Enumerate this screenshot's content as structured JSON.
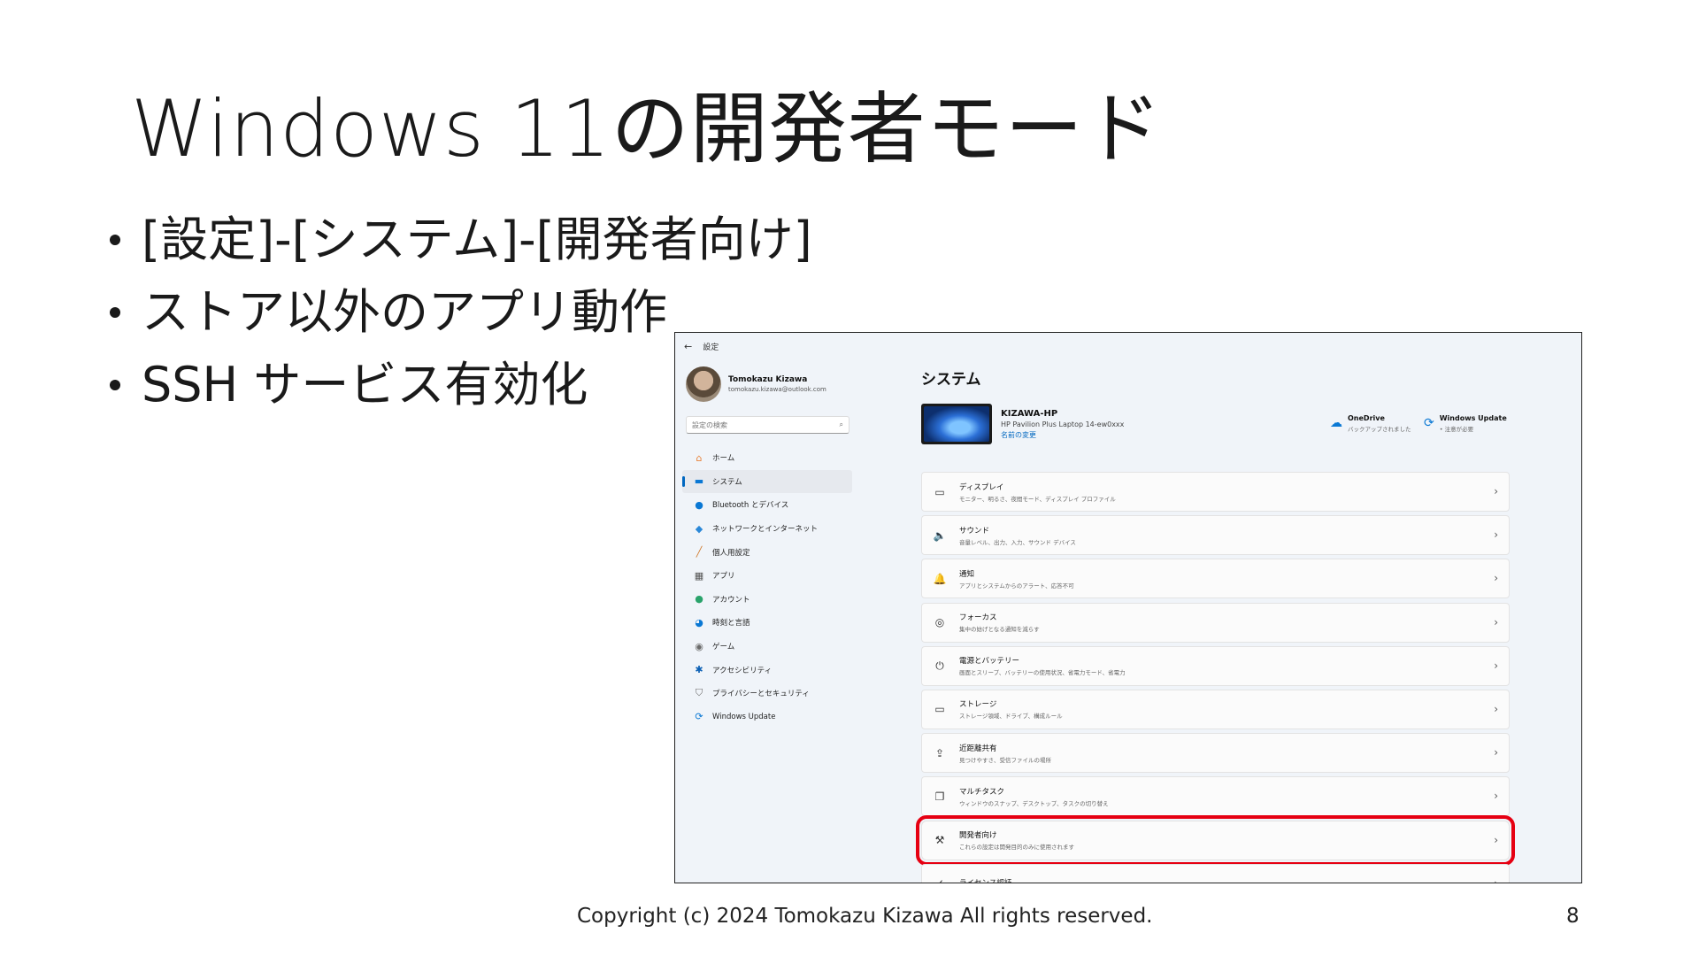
{
  "slide": {
    "title": "Windows 11の開発者モード",
    "bullets": [
      "[設定]-[システム]-[開発者向け]",
      "ストア以外のアプリ動作",
      "SSH サービス有効化"
    ],
    "footer": "Copyright (c) 2024 Tomokazu Kizawa All rights reserved.",
    "page_number": "8"
  },
  "settings": {
    "window_title": "設定",
    "back_glyph": "←",
    "profile": {
      "name": "Tomokazu Kizawa",
      "email": "tomokazu.kizawa@outlook.com"
    },
    "search": {
      "placeholder": "設定の検索",
      "icon": "search-icon"
    },
    "nav": [
      {
        "label": "ホーム",
        "icon": "home-icon",
        "glyph": "⌂",
        "color": "#e8833a"
      },
      {
        "label": "システム",
        "icon": "monitor-icon",
        "glyph": "▬",
        "color": "#0a78d4",
        "active": true
      },
      {
        "label": "Bluetooth とデバイス",
        "icon": "bluetooth-icon",
        "glyph": "●",
        "color": "#0a78d4"
      },
      {
        "label": "ネットワークとインターネット",
        "icon": "wifi-icon",
        "glyph": "◆",
        "color": "#2b88d8"
      },
      {
        "label": "個人用設定",
        "icon": "brush-icon",
        "glyph": "╱",
        "color": "#d07a2d"
      },
      {
        "label": "アプリ",
        "icon": "apps-icon",
        "glyph": "▦",
        "color": "#555555"
      },
      {
        "label": "アカウント",
        "icon": "account-icon",
        "glyph": "●",
        "color": "#2aa36b"
      },
      {
        "label": "時刻と言語",
        "icon": "globe-icon",
        "glyph": "◕",
        "color": "#0a78d4"
      },
      {
        "label": "ゲーム",
        "icon": "gamepad-icon",
        "glyph": "◉",
        "color": "#6b6b6b"
      },
      {
        "label": "アクセシビリティ",
        "icon": "accessibility-icon",
        "glyph": "✱",
        "color": "#0a5fb4"
      },
      {
        "label": "プライバシーとセキュリティ",
        "icon": "shield-icon",
        "glyph": "⛉",
        "color": "#6b6b6b"
      },
      {
        "label": "Windows Update",
        "icon": "update-icon",
        "glyph": "⟳",
        "color": "#0a78d4"
      }
    ],
    "main": {
      "title": "システム",
      "device": {
        "name": "KIZAWA-HP",
        "model": "HP Pavilion Plus Laptop 14-ew0xxx",
        "rename": "名前の変更"
      },
      "onedrive": {
        "title": "OneDrive",
        "sub": "バックアップされました",
        "glyph": "☁"
      },
      "windows_update": {
        "title": "Windows Update",
        "sub": "• 注意が必要",
        "glyph": "⟳"
      },
      "cards": [
        {
          "title": "ディスプレイ",
          "sub": "モニター、明るさ、夜間モード、ディスプレイ プロファイル",
          "icon": "display-icon",
          "glyph": "▭"
        },
        {
          "title": "サウンド",
          "sub": "音量レベル、出力、入力、サウンド デバイス",
          "icon": "speaker-icon",
          "glyph": "🔈"
        },
        {
          "title": "通知",
          "sub": "アプリとシステムからのアラート、応答不可",
          "icon": "bell-icon",
          "glyph": "🔔"
        },
        {
          "title": "フォーカス",
          "sub": "集中の妨げとなる通知を減らす",
          "icon": "focus-icon",
          "glyph": "◎"
        },
        {
          "title": "電源とバッテリー",
          "sub": "画面とスリープ、バッテリーの使用状況、省電力モード、省電力",
          "icon": "power-icon",
          "glyph": "⏻"
        },
        {
          "title": "ストレージ",
          "sub": "ストレージ領域、ドライブ、構成ルール",
          "icon": "storage-icon",
          "glyph": "▭"
        },
        {
          "title": "近距離共有",
          "sub": "見つけやすさ、受信ファイルの場所",
          "icon": "share-icon",
          "glyph": "⇪"
        },
        {
          "title": "マルチタスク",
          "sub": "ウィンドウのスナップ、デスクトップ、タスクの切り替え",
          "icon": "multitask-icon",
          "glyph": "❐"
        },
        {
          "title": "開発者向け",
          "sub": "これらの設定は開発目的のみに使用されます",
          "icon": "developer-tools-icon",
          "glyph": "⚒",
          "highlighted": true
        },
        {
          "title": "ライセンス認証",
          "sub": "",
          "icon": "activation-icon",
          "glyph": "✓"
        }
      ],
      "chevron": "›"
    },
    "colors": {
      "highlight": "#e60012",
      "accent": "#0067c0",
      "window_bg": "#f0f4f9"
    }
  }
}
